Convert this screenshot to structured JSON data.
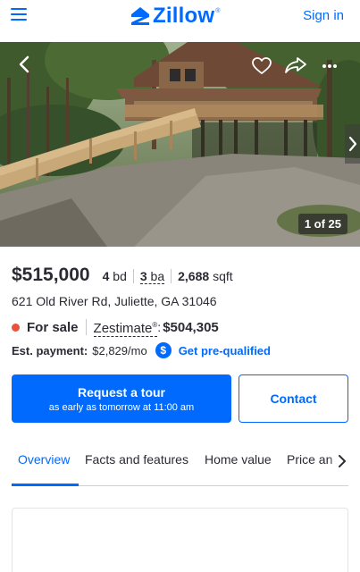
{
  "header": {
    "logo_text": "Zillow",
    "logo_mark": "®",
    "signin_label": "Sign in"
  },
  "photo": {
    "counter": "1 of 25"
  },
  "listing": {
    "price": "$515,000",
    "beds_value": "4",
    "beds_unit": "bd",
    "baths_value": "3",
    "baths_unit": "ba",
    "sqft_value": "2,688",
    "sqft_unit": "sqft",
    "address": "621 Old River Rd, Juliette, GA 31046",
    "status": "For sale",
    "zestimate_label": "Zestimate",
    "zestimate_mark": "®",
    "zestimate_sep": ":",
    "zestimate_value": "$504,305",
    "payment_label": "Est. payment:",
    "payment_value": "$2,829/mo",
    "prequal_icon_glyph": "$",
    "prequal_label": "Get pre-qualified"
  },
  "actions": {
    "tour_label": "Request a tour",
    "tour_sub": "as early as tomorrow at 11:00 am",
    "contact_label": "Contact"
  },
  "tabs": [
    {
      "label": "Overview",
      "active": true
    },
    {
      "label": "Facts and features",
      "active": false
    },
    {
      "label": "Home value",
      "active": false
    },
    {
      "label": "Price an",
      "active": false
    }
  ],
  "colors": {
    "brand_blue": "#006aff",
    "status_dot": "#ee4e3c",
    "text": "#2a2a33"
  },
  "icons": [
    "hamburger-menu-icon",
    "zillow-logo-icon",
    "chevron-left-icon",
    "heart-icon",
    "share-icon",
    "more-icon",
    "chevron-right-icon",
    "dollar-icon",
    "tab-scroll-right-icon"
  ]
}
